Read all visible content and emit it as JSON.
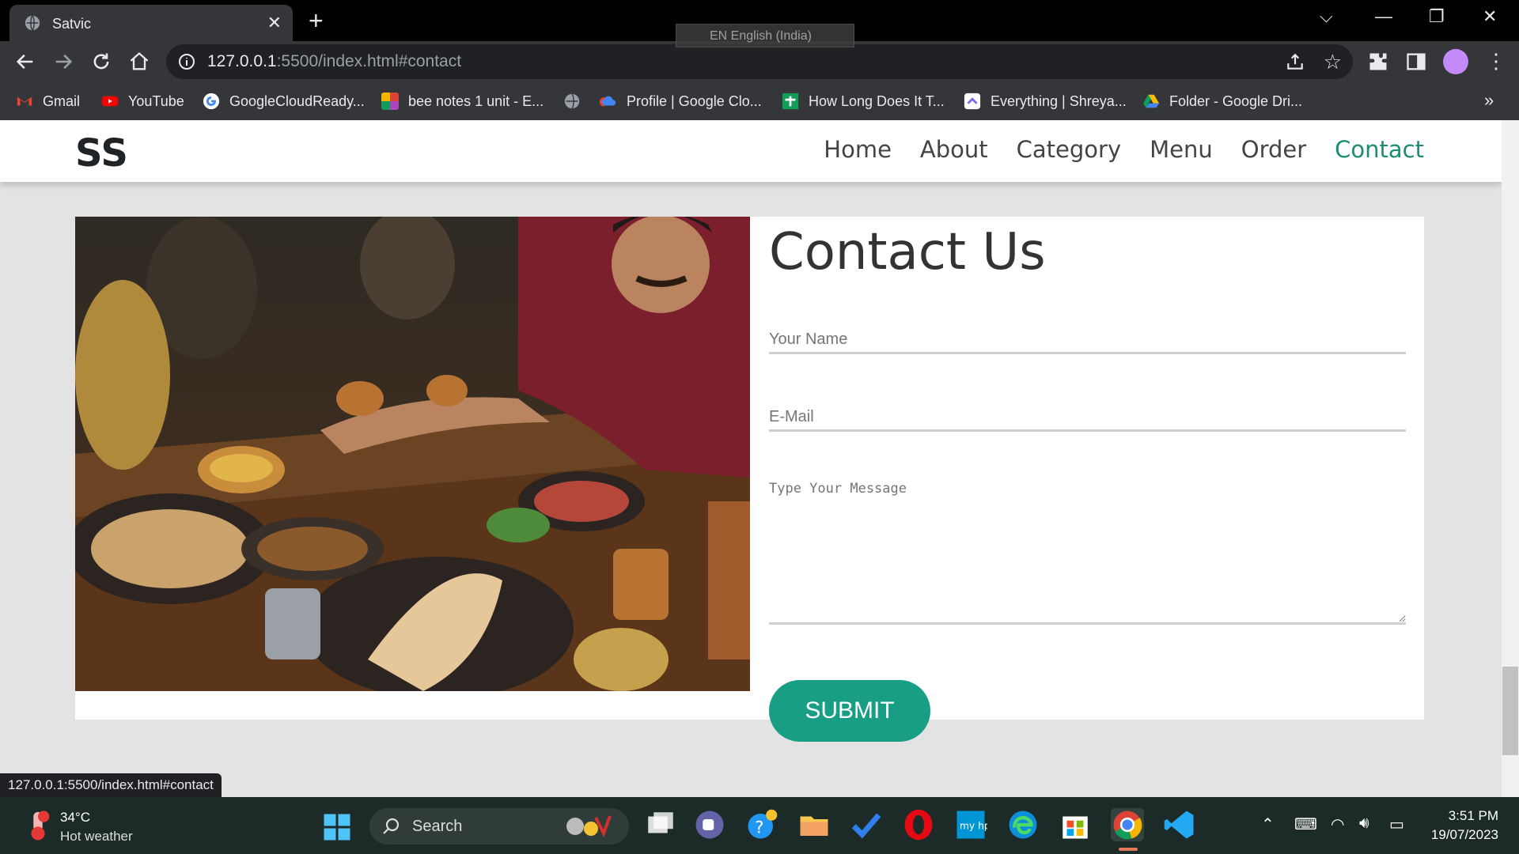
{
  "browser": {
    "tab_title": "Satvic",
    "url_host": "127.0.0.1",
    "url_path": ":5500/index.html#contact",
    "language_indicator": "EN English (India)",
    "status_url": "127.0.0.1:5500/index.html#contact",
    "bookmarks": [
      {
        "label": "Gmail",
        "icon": "gmail-icon"
      },
      {
        "label": "YouTube",
        "icon": "youtube-icon"
      },
      {
        "label": "GoogleCloudReady...",
        "icon": "google-icon"
      },
      {
        "label": "bee notes 1 unit - E...",
        "icon": "colorful-grid-icon"
      },
      {
        "label": "",
        "icon": "globe-icon"
      },
      {
        "label": "Profile | Google Clo...",
        "icon": "google-cloud-icon"
      },
      {
        "label": "How Long Does It T...",
        "icon": "green-plus-icon"
      },
      {
        "label": "Everything | Shreya...",
        "icon": "clickup-icon"
      },
      {
        "label": "Folder - Google Dri...",
        "icon": "google-drive-icon"
      }
    ]
  },
  "site": {
    "logo": "SS",
    "nav": [
      "Home",
      "About",
      "Category",
      "Menu",
      "Order",
      "Contact"
    ],
    "active_nav": "Contact",
    "accent_color": "#1e8c74",
    "contact": {
      "title": "Contact Us",
      "name_placeholder": "Your Name",
      "email_placeholder": "E-Mail",
      "message_placeholder": "Type Your Message",
      "submit_label": "SUBMIT"
    }
  },
  "taskbar": {
    "temperature": "34°C",
    "weather": "Hot weather",
    "search_label": "Search",
    "time": "3:51 PM",
    "date": "19/07/2023"
  }
}
